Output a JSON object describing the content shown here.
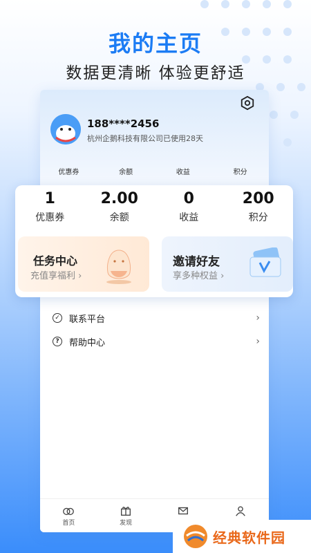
{
  "headline": "我的主页",
  "subline": "数据更清晰 体验更舒适",
  "profile": {
    "phone": "188****2456",
    "company": "杭州企鹅科技有限公司已使用28天"
  },
  "mini_stats": [
    "优惠券",
    "余额",
    "收益",
    "积分"
  ],
  "stats": [
    {
      "value": "1",
      "label": "优惠券"
    },
    {
      "value": "2.00",
      "label": "余额"
    },
    {
      "value": "0",
      "label": "收益"
    },
    {
      "value": "200",
      "label": "积分"
    }
  ],
  "promos": {
    "task": {
      "title": "任务中心",
      "sub": "充值享福利 ›"
    },
    "invite": {
      "title": "邀请好友",
      "sub": "享多种权益 ›"
    }
  },
  "menu": [
    {
      "label": "联系平台",
      "icon": "leaf-icon"
    },
    {
      "label": "帮助中心",
      "icon": "question-icon"
    }
  ],
  "tabs": [
    {
      "label": "首页",
      "icon": "home-icon"
    },
    {
      "label": "发现",
      "icon": "gift-icon"
    },
    {
      "label": "",
      "icon": "mail-icon"
    },
    {
      "label": "",
      "icon": "user-icon"
    }
  ],
  "watermark": "经典软件园",
  "colors": {
    "accent": "#1c7cf4",
    "watermark": "#e9681a"
  }
}
